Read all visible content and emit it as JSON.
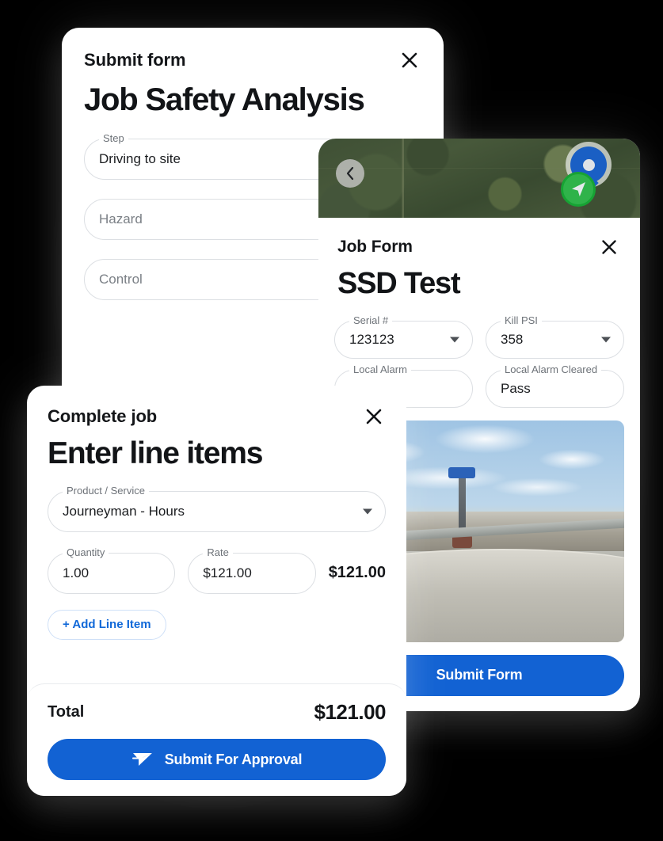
{
  "cards": {
    "jsa": {
      "eyebrow": "Submit form",
      "title": "Job Safety Analysis",
      "close_icon": "close-icon",
      "fields": [
        {
          "legend": "Step",
          "value": "Driving to site",
          "is_placeholder": false
        },
        {
          "legend": "",
          "value": "Hazard",
          "is_placeholder": true
        },
        {
          "legend": "",
          "value": "Control",
          "is_placeholder": true
        }
      ]
    },
    "job_form": {
      "eyebrow": "Job Form",
      "title": "SSD Test",
      "close_icon": "close-icon",
      "map": {
        "back_icon": "chevron-left-icon",
        "pin_icon": "map-pin-icon",
        "location_icon": "navigation-arrow-icon"
      },
      "fields": [
        {
          "legend": "Serial #",
          "value": "123123",
          "dropdown": true
        },
        {
          "legend": "Kill PSI",
          "value": "358",
          "dropdown": true
        },
        {
          "legend": "Local Alarm",
          "value": "",
          "dropdown": false
        },
        {
          "legend": "Local Alarm Cleared",
          "value": "Pass",
          "dropdown": false
        }
      ],
      "photo_alt": "storage-tank-photo",
      "submit_label": "Submit Form"
    },
    "line_items": {
      "eyebrow": "Complete job",
      "title": "Enter line items",
      "close_icon": "close-icon",
      "product_field": {
        "legend": "Product / Service",
        "value": "Journeyman - Hours"
      },
      "quantity_field": {
        "legend": "Quantity",
        "value": "1.00"
      },
      "rate_field": {
        "legend": "Rate",
        "value": "$121.00"
      },
      "line_amount": "$121.00",
      "add_line_label": "+ Add Line Item",
      "total_label": "Total",
      "total_amount": "$121.00",
      "submit_label": "Submit For Approval",
      "submit_icon": "send-icon"
    }
  },
  "colors": {
    "accent_blue": "#1262d3",
    "link_blue": "#1068d8",
    "text_dark": "#121417",
    "label_gray": "#6d7278",
    "border_gray": "#dcdfe3",
    "marker_blue": "#1a5fc4",
    "marker_green": "#2fb34a"
  }
}
